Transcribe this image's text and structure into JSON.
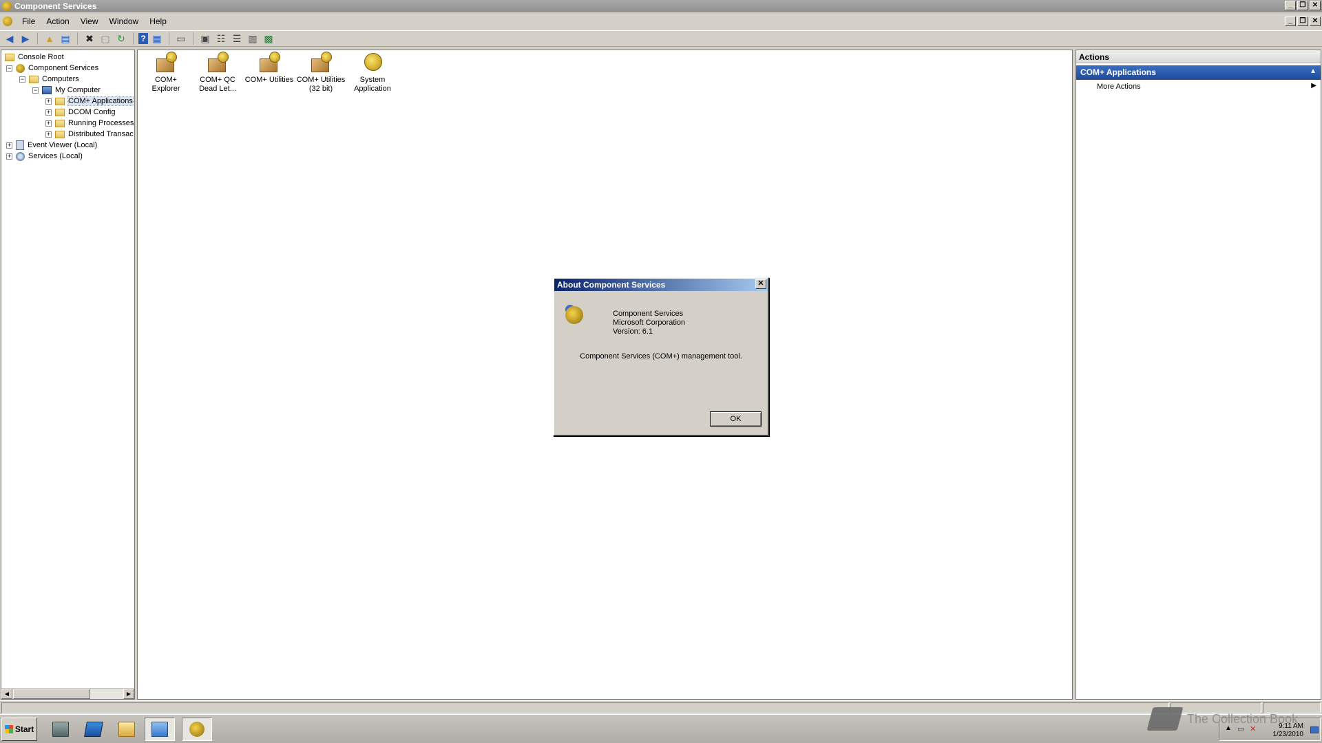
{
  "window": {
    "title": "Component Services"
  },
  "menu": [
    "File",
    "Action",
    "View",
    "Window",
    "Help"
  ],
  "tree": [
    {
      "label": "Console Root"
    },
    {
      "label": "Component Services"
    },
    {
      "label": "Computers"
    },
    {
      "label": "My Computer"
    },
    {
      "label": "COM+ Applications"
    },
    {
      "label": "DCOM Config"
    },
    {
      "label": "Running Processes"
    },
    {
      "label": "Distributed Transac"
    },
    {
      "label": "Event Viewer (Local)"
    },
    {
      "label": "Services (Local)"
    }
  ],
  "list_items": [
    {
      "line1": "COM+",
      "line2": "Explorer"
    },
    {
      "line1": "COM+ QC",
      "line2": "Dead Let..."
    },
    {
      "line1": "COM+ Utilities",
      "line2": ""
    },
    {
      "line1": "COM+ Utilities",
      "line2": "(32 bit)"
    },
    {
      "line1": "System",
      "line2": "Application"
    }
  ],
  "actions": {
    "header": "Actions",
    "group": "COM+ Applications",
    "item": "More Actions"
  },
  "dialog": {
    "title": "About Component Services",
    "product": "Component Services",
    "company": "Microsoft Corporation",
    "version": "Version: 6.1",
    "description": "Component Services (COM+) management tool.",
    "ok_label": "OK"
  },
  "taskbar": {
    "start_label": "Start",
    "clock_time": "9:11 AM",
    "clock_date": "1/23/2010",
    "watermark": "The Collection Book"
  }
}
